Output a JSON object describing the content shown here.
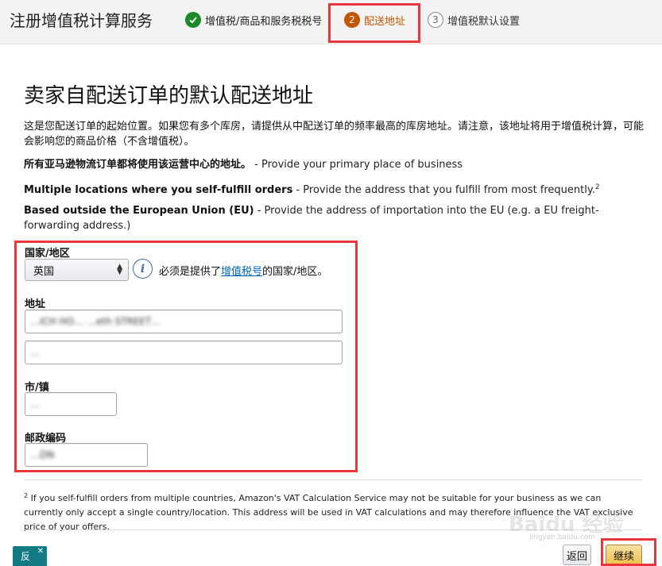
{
  "header": {
    "title": "注册增值税计算服务",
    "steps": [
      {
        "number": "✓",
        "label": "增值税/商品和服务税税号",
        "state": "done"
      },
      {
        "number": "2",
        "label": "配送地址",
        "state": "active"
      },
      {
        "number": "3",
        "label": "增值税默认设置",
        "state": "pending"
      }
    ]
  },
  "main": {
    "title": "卖家自配送订单的默认配送地址",
    "description": "这是您配送订单的起始位置。如果您有多个库房，请提供从中配送订单的频率最高的库房地址。请注意，该地址将用于增值税计算，可能会影响您的商品价格（不含增值税）。",
    "info_lines": [
      {
        "bold": "所有亚马逊物流订单都将使用该运营中心的地址。",
        "text": " - Provide your primary place of business"
      },
      {
        "bold": "Multiple locations where you self-fulfill orders",
        "text": " - Provide the address that you fulfill from most frequently.",
        "sup": "2"
      },
      {
        "bold": "Based outside the European Union (EU)",
        "text": " - Provide the address of importation into the EU (e.g. a EU freight-forwarding address.)"
      }
    ]
  },
  "form": {
    "country_label": "国家/地区",
    "country_value": "英国",
    "country_note_pre": "必须是提供了",
    "country_note_link": "增值税号",
    "country_note_post": "的国家/地区。",
    "address_label": "地址",
    "address_line1": "…ICH HO… …eth STREET…",
    "address_line2": "…",
    "city_label": "市/镇",
    "city_value": "…",
    "postal_label": "邮政编码",
    "postal_value": "…DN"
  },
  "footnote": {
    "sup": "2",
    "text": " If you self-fulfill orders from multiple countries, Amazon's VAT Calculation Service may not be suitable for your business as we can currently only accept a single country/location. This address will be used in VAT calculations and may therefore influence the VAT exclusive price of your offers."
  },
  "footer": {
    "feedback_label": "反",
    "feedback_close": "✕",
    "back_label": "返回",
    "continue_label": "继续"
  },
  "watermark": {
    "main": "Baidu 经验",
    "sub": "jingyan.baidu.com"
  },
  "colors": {
    "active_step": "#c45500",
    "done_step": "#1c8a2b",
    "highlight": "#e8363d",
    "link": "#0066c0",
    "primary_button": "#f0c14b"
  }
}
